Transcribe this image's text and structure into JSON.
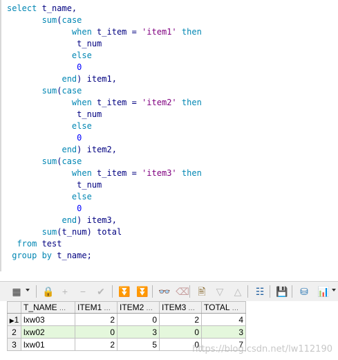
{
  "editor": {
    "lines": [
      [
        {
          "t": "kw",
          "v": "select"
        },
        {
          "t": "id",
          "v": " t_name,"
        }
      ],
      [
        {
          "t": "ws",
          "v": "       "
        },
        {
          "t": "kw",
          "v": "sum"
        },
        {
          "t": "id",
          "v": "("
        },
        {
          "t": "kw",
          "v": "case"
        }
      ],
      [
        {
          "t": "ws",
          "v": "             "
        },
        {
          "t": "kw",
          "v": "when"
        },
        {
          "t": "id",
          "v": " t_item = "
        },
        {
          "t": "str",
          "v": "'item1'"
        },
        {
          "t": "id",
          "v": " "
        },
        {
          "t": "kw",
          "v": "then"
        }
      ],
      [
        {
          "t": "ws",
          "v": "              "
        },
        {
          "t": "id",
          "v": "t_num"
        }
      ],
      [
        {
          "t": "ws",
          "v": "             "
        },
        {
          "t": "kw",
          "v": "else"
        }
      ],
      [
        {
          "t": "ws",
          "v": "              "
        },
        {
          "t": "num",
          "v": "0"
        }
      ],
      [
        {
          "t": "ws",
          "v": "           "
        },
        {
          "t": "kw",
          "v": "end"
        },
        {
          "t": "id",
          "v": ") item1,"
        }
      ],
      [
        {
          "t": "ws",
          "v": "       "
        },
        {
          "t": "kw",
          "v": "sum"
        },
        {
          "t": "id",
          "v": "("
        },
        {
          "t": "kw",
          "v": "case"
        }
      ],
      [
        {
          "t": "ws",
          "v": "             "
        },
        {
          "t": "kw",
          "v": "when"
        },
        {
          "t": "id",
          "v": " t_item = "
        },
        {
          "t": "str",
          "v": "'item2'"
        },
        {
          "t": "id",
          "v": " "
        },
        {
          "t": "kw",
          "v": "then"
        }
      ],
      [
        {
          "t": "ws",
          "v": "              "
        },
        {
          "t": "id",
          "v": "t_num"
        }
      ],
      [
        {
          "t": "ws",
          "v": "             "
        },
        {
          "t": "kw",
          "v": "else"
        }
      ],
      [
        {
          "t": "ws",
          "v": "              "
        },
        {
          "t": "num",
          "v": "0"
        }
      ],
      [
        {
          "t": "ws",
          "v": "           "
        },
        {
          "t": "kw",
          "v": "end"
        },
        {
          "t": "id",
          "v": ") item2,"
        }
      ],
      [
        {
          "t": "ws",
          "v": "       "
        },
        {
          "t": "kw",
          "v": "sum"
        },
        {
          "t": "id",
          "v": "("
        },
        {
          "t": "kw",
          "v": "case"
        }
      ],
      [
        {
          "t": "ws",
          "v": "             "
        },
        {
          "t": "kw",
          "v": "when"
        },
        {
          "t": "id",
          "v": " t_item = "
        },
        {
          "t": "str",
          "v": "'item3'"
        },
        {
          "t": "id",
          "v": " "
        },
        {
          "t": "kw",
          "v": "then"
        }
      ],
      [
        {
          "t": "ws",
          "v": "              "
        },
        {
          "t": "id",
          "v": "t_num"
        }
      ],
      [
        {
          "t": "ws",
          "v": "             "
        },
        {
          "t": "kw",
          "v": "else"
        }
      ],
      [
        {
          "t": "ws",
          "v": "              "
        },
        {
          "t": "num",
          "v": "0"
        }
      ],
      [
        {
          "t": "ws",
          "v": "           "
        },
        {
          "t": "kw",
          "v": "end"
        },
        {
          "t": "id",
          "v": ") item3,"
        }
      ],
      [
        {
          "t": "ws",
          "v": "       "
        },
        {
          "t": "kw",
          "v": "sum"
        },
        {
          "t": "id",
          "v": "(t_num) total"
        }
      ],
      [
        {
          "t": "ws",
          "v": "  "
        },
        {
          "t": "kw",
          "v": "from"
        },
        {
          "t": "id",
          "v": " test"
        }
      ],
      [
        {
          "t": "ws",
          "v": " "
        },
        {
          "t": "kw",
          "v": "group by"
        },
        {
          "t": "id",
          "v": " t_name;"
        }
      ]
    ]
  },
  "toolbar": {
    "buttons": [
      {
        "name": "grid-view-icon",
        "glyph": "▦",
        "color": "#333333",
        "clickable": true
      },
      {
        "name": "lock-icon",
        "glyph": "🔒",
        "color": "#555555",
        "clickable": true
      },
      {
        "name": "add-record-icon",
        "glyph": "+",
        "color": "#b8b8b8",
        "clickable": false
      },
      {
        "name": "delete-record-icon",
        "glyph": "−",
        "color": "#b8b8b8",
        "clickable": false
      },
      {
        "name": "post-changes-icon",
        "glyph": "✔",
        "color": "#b8b8b8",
        "clickable": false
      },
      {
        "name": "fetch-next-icon",
        "glyph": "⏬",
        "color": "#9acb8a",
        "clickable": true
      },
      {
        "name": "fetch-last-icon",
        "glyph": "⏬",
        "color": "#9acb8a",
        "clickable": true
      },
      {
        "name": "binoculars-icon",
        "glyph": "👓",
        "color": "#333333",
        "clickable": true
      },
      {
        "name": "clear-icon",
        "glyph": "⌫",
        "color": "#c8a0a0",
        "clickable": false
      },
      {
        "name": "query-by-example-icon",
        "glyph": "🖹",
        "color": "#806020",
        "clickable": true
      },
      {
        "name": "sort-down-icon",
        "glyph": "▽",
        "color": "#b8b8b8",
        "clickable": false
      },
      {
        "name": "sort-up-icon",
        "glyph": "△",
        "color": "#b8b8b8",
        "clickable": false
      },
      {
        "name": "tree-view-icon",
        "glyph": "☷",
        "color": "#2060a0",
        "clickable": true
      },
      {
        "name": "save-icon",
        "glyph": "💾",
        "color": "#333333",
        "clickable": true
      },
      {
        "name": "export-icon",
        "glyph": "⛁",
        "color": "#2070b0",
        "clickable": true
      },
      {
        "name": "chart-icon",
        "glyph": "📊",
        "color": "#c03030",
        "clickable": true
      }
    ]
  },
  "grid": {
    "columns": [
      {
        "label": "T_NAME",
        "align": "left"
      },
      {
        "label": "ITEM1",
        "align": "right"
      },
      {
        "label": "ITEM2",
        "align": "right"
      },
      {
        "label": "ITEM3",
        "align": "right"
      },
      {
        "label": "TOTAL",
        "align": "right"
      }
    ],
    "rows": [
      {
        "n": "1",
        "current": true,
        "cells": [
          "lxw03",
          "2",
          "0",
          "2",
          "4"
        ]
      },
      {
        "n": "2",
        "current": false,
        "cells": [
          "lxw02",
          "0",
          "3",
          "0",
          "3"
        ]
      },
      {
        "n": "3",
        "current": false,
        "cells": [
          "lxw01",
          "2",
          "5",
          "0",
          "7"
        ]
      }
    ],
    "current_marker": "▶",
    "sort_glyph": "…"
  },
  "watermark": "https://blog.csdn.net/lw112190"
}
